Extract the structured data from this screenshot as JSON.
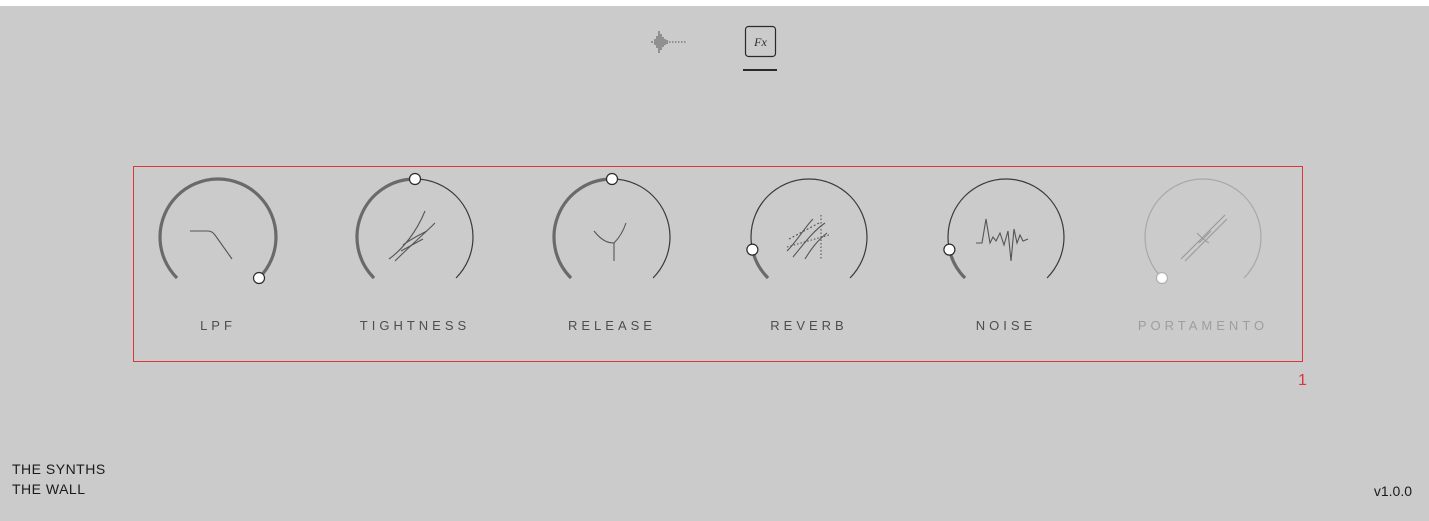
{
  "tabs": [
    {
      "name": "waveform",
      "icon": "waveform-icon",
      "active": false
    },
    {
      "name": "fx",
      "label": "Fx",
      "icon": "fx-icon",
      "active": true
    }
  ],
  "highlight": {
    "index": "1",
    "color": "#d9363e"
  },
  "knobs": [
    {
      "id": "lpf",
      "label": "LPF",
      "value": 1.0,
      "icon": "lowpass-filter-icon",
      "disabled": false
    },
    {
      "id": "tightness",
      "label": "TIGHTNESS",
      "value": 0.5,
      "icon": "tightness-icon",
      "disabled": false
    },
    {
      "id": "release",
      "label": "RELEASE",
      "value": 0.5,
      "icon": "release-icon",
      "disabled": false
    },
    {
      "id": "reverb",
      "label": "REVERB",
      "value": 0.12,
      "icon": "reverb-icon",
      "disabled": false
    },
    {
      "id": "noise",
      "label": "NOISE",
      "value": 0.12,
      "icon": "noise-icon",
      "disabled": false
    },
    {
      "id": "portamento",
      "label": "PORTAMENTO",
      "value": 0.0,
      "icon": "portamento-icon",
      "disabled": true
    }
  ],
  "footer": {
    "line1": "THE SYNTHS",
    "line2": "THE WALL",
    "version": "v1.0.0"
  },
  "colors": {
    "background": "#cbcbcb",
    "knob_stroke": "#3a3a3a",
    "knob_active": "#6a6a6a",
    "disabled": "#a8a8a8"
  }
}
